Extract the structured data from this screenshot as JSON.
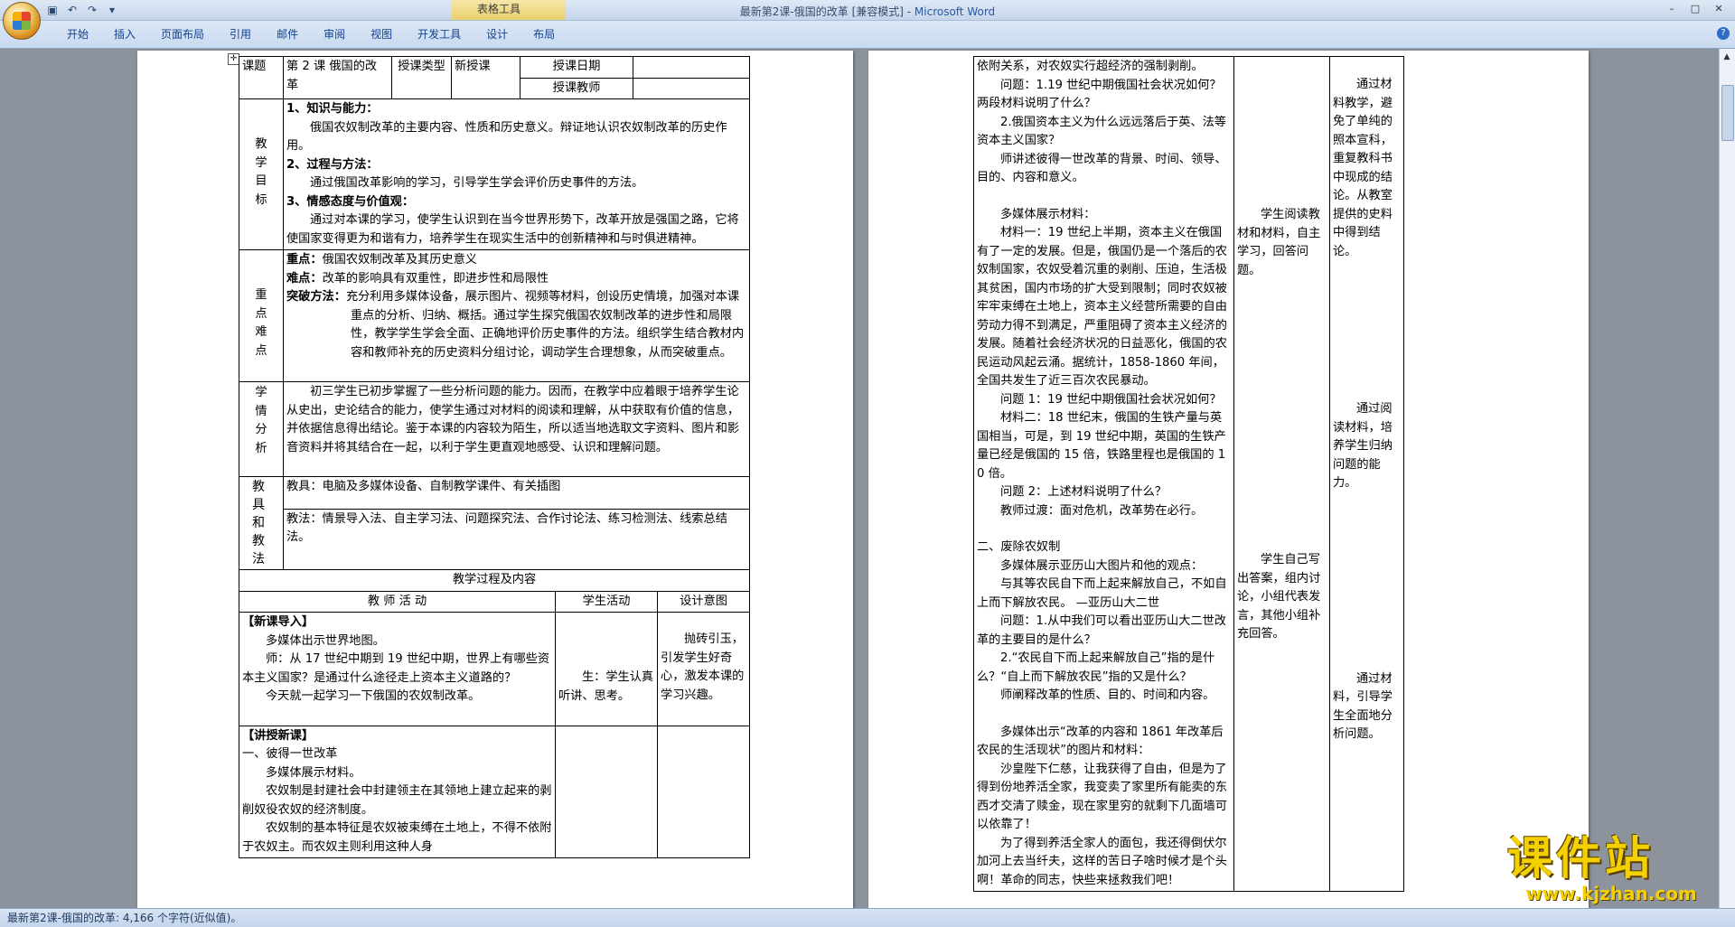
{
  "window": {
    "title": "最新第2课-俄国的改革 [兼容模式] - ",
    "app_name": "Microsoft Word",
    "context_tools_label": "表格工具"
  },
  "ribbon": {
    "tabs": [
      "开始",
      "插入",
      "页面布局",
      "引用",
      "邮件",
      "审阅",
      "视图",
      "开发工具",
      "设计",
      "布局"
    ]
  },
  "status": {
    "text": "最新第2课-俄国的改革: 4,166 个字符(近似值)。"
  },
  "watermark": {
    "brand": "课件站",
    "url": "www.kjzhan.com"
  },
  "page1": {
    "header": {
      "topic_label": "课题",
      "topic_value": "第 2 课 俄国的改革",
      "type_label": "授课类型",
      "type_value": "新授课",
      "date_label": "授课日期",
      "date_value": "",
      "teacher_label": "授课教师",
      "teacher_value": ""
    },
    "goals": {
      "label": [
        "教",
        "学",
        "目",
        "标"
      ],
      "h1": "1、知识与能力：",
      "p1": "俄国农奴制改革的主要内容、性质和历史意义。辩证地认识农奴制改革的历史作用。",
      "h2": "2、过程与方法：",
      "p2": "通过俄国改革影响的学习，引导学生学会评价历史事件的方法。",
      "h3": "3、情感态度与价值观：",
      "p3": "通过对本课的学习，使学生认识到在当今世界形势下，改革开放是强国之路，它将使国家变得更为和谐有力，培养学生在现实生活中的创新精神和与时俱进精神。"
    },
    "key": {
      "label": [
        "重",
        "点",
        "难",
        "点"
      ],
      "zhongdian_label": "重点：",
      "zhongdian": "俄国农奴制改革及其历史意义",
      "nandian_label": "难点：",
      "nandian": "改革的影响具有双重性，即进步性和局限性",
      "tupo_label": "突破方法：",
      "tupo": "充分利用多媒体设备，展示图片、视频等材料，创设历史情境，加强对本课重点的分析、归纳、概括。通过学生探究俄国农奴制改革的进步性和局限性，教学学生学会全面、正确地评价历史事件的方法。组织学生结合教材内容和教师补充的历史资料分组讨论，调动学生合理想象，从而突破重点。"
    },
    "xueqing": {
      "label": [
        "学",
        "情",
        "分",
        "析"
      ],
      "text": "初三学生已初步掌握了一些分析问题的能力。因而，在教学中应着眼于培养学生论从史出，史论结合的能力，使学生通过对材料的阅读和理解，从中获取有价值的信息，并依据信息得出结论。鉴于本课的内容较为陌生，所以适当地选取文字资料、图片和影音资料并将其结合在一起，以利于学生更直观地感受、认识和理解问题。"
    },
    "tools": {
      "label": "教 具 和 教 法",
      "jiaoju": "教具：电脑及多媒体设备、自制教学课件、有关插图",
      "jiaofa": "教法：情景导入法、自主学习法、问题探究法、合作讨论法、练习检测法、线索总结法。"
    },
    "process_title": "教学过程及内容",
    "cols": {
      "teacher": "教  师  活  动",
      "student": "学生活动",
      "design": "设计意图"
    },
    "intro": {
      "title": "【新课导入】",
      "lines": [
        "多媒体出示世界地图。",
        "师：从 17 世纪中期到 19 世纪中期，世界上有哪些资本主义国家？是通过什么途径走上资本主义道路的？",
        "今天就一起学习一下俄国的农奴制改革。"
      ],
      "student": "生：学生认真听讲、思考。",
      "design": "抛砖引玉，引发学生好奇心，激发本课的学习兴趣。"
    },
    "new": {
      "title": "【讲授新课】",
      "lines": [
        "一、彼得一世改革",
        "多媒体展示材料。",
        "农奴制是封建社会中封建领主在其领地上建立起来的剥削奴役农奴的经济制度。",
        "农奴制的基本特征是农奴被束缚在土地上，不得不依附于农奴主。而农奴主则利用这种人身"
      ]
    }
  },
  "page2": {
    "teacher": [
      {
        "t": "依附关系，对农奴实行超经济的强制剥削。",
        "ind": false
      },
      {
        "t": "问题：1.19 世纪中期俄国社会状况如何？两段材料说明了什么？",
        "ind": true
      },
      {
        "t": "2.俄国资本主义为什么远远落后于英、法等资本主义国家？",
        "ind": true
      },
      {
        "t": "师讲述彼得一世改革的背景、时间、领导、目的、内容和意义。",
        "ind": true
      },
      {
        "t": "",
        "ind": false
      },
      {
        "t": "多媒体展示材料：",
        "ind": true
      },
      {
        "t": "材料一：19 世纪上半期，资本主义在俄国有了一定的发展。但是，俄国仍是一个落后的农奴制国家，农奴受着沉重的剥削、压迫，生活极其贫困，国内市场的扩大受到限制；同时农奴被牢牢束缚在土地上，资本主义经营所需要的自由劳动力得不到满足，严重阻碍了资本主义经济的发展。随着社会经济状况的日益恶化，俄国的农民运动风起云涌。据统计，1858-1860 年间，全国共发生了近三百次农民暴动。",
        "ind": true
      },
      {
        "t": "问题 1：19 世纪中期俄国社会状况如何？",
        "ind": true
      },
      {
        "t": "材料二：18 世纪末，俄国的生铁产量与英国相当，可是，到 19 世纪中期，英国的生铁产量已经是俄国的 15 倍，铁路里程也是俄国的 10 倍。",
        "ind": true
      },
      {
        "t": "问题 2：上述材料说明了什么？",
        "ind": true
      },
      {
        "t": "教师过渡：面对危机，改革势在必行。",
        "ind": true
      },
      {
        "t": "",
        "ind": false
      },
      {
        "t": "二、废除农奴制",
        "ind": false
      },
      {
        "t": "多媒体展示亚历山大图片和他的观点：",
        "ind": true
      },
      {
        "t": "与其等农民自下而上起来解放自己，不如自上而下解放农民。     —亚历山大二世",
        "ind": true
      },
      {
        "t": "问题：1.从中我们可以看出亚历山大二世改革的主要目的是什么？",
        "ind": true
      },
      {
        "t": "2.“农民自下而上起来解放自己”指的是什么？“自上而下解放农民”指的又是什么？",
        "ind": true
      },
      {
        "t": "师阐释改革的性质、目的、时间和内容。",
        "ind": true
      },
      {
        "t": "",
        "ind": false
      },
      {
        "t": "多媒体出示“改革的内容和 1861 年改革后农民的生活现状”的图片和材料：",
        "ind": true
      },
      {
        "t": "沙皇陛下仁慈，让我获得了自由，但是为了得到份地养活全家，我变卖了家里所有能卖的东西才交清了赎金，现在家里穷的就剩下几面墙可以依靠了！",
        "ind": true
      },
      {
        "t": "为了得到养活全家人的面包，我还得倒伏尔加河上去当纤夫，这样的苦日子啥时候才是个头啊！革命的同志，快些来拯救我们吧！",
        "ind": true
      }
    ],
    "student1": "学生阅读教材和材料，自主学习，回答问题。",
    "student2": "学生自己写出答案，组内讨论，小组代表发言，其他小组补充回答。",
    "design1": "通过材料教学，避免了单纯的照本宣科，重复教科书中现成的结论。从教室提供的史料中得到结论。",
    "design2": "通过阅读材料，培养学生归纳问题的能力。",
    "design3": "通过材料，引导学生全面地分析问题。"
  }
}
